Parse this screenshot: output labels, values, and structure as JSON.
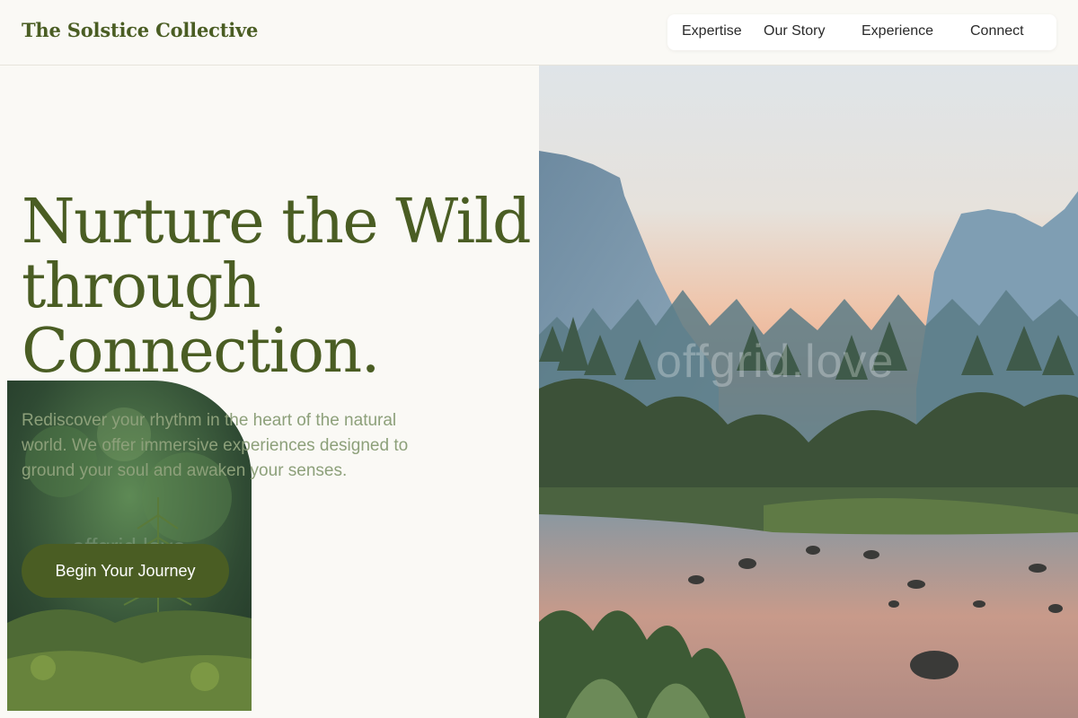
{
  "brand": {
    "name": "The Solstice Collective"
  },
  "nav": {
    "items": [
      {
        "label": "Expertise"
      },
      {
        "label": "Our Story"
      },
      {
        "label": "Experience"
      },
      {
        "label": "Connect"
      }
    ]
  },
  "hero": {
    "title_lines": [
      "Nurture the Wild",
      "through",
      "Connection."
    ],
    "subtitle": "Rediscover your rhythm in the heart of the natural world. We offer immersive experiences designed to ground your soul and awaken your senses.",
    "cta_label": "Begin Your Journey"
  },
  "images": {
    "landscape_watermark": "offgrid.love",
    "forest_watermark": "offgrid.love"
  },
  "colors": {
    "brand_green": "#4a5d23",
    "background": "#faf9f5",
    "subtitle_green": "#8da07a"
  }
}
